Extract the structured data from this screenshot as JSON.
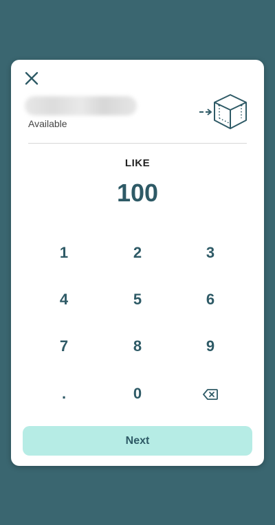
{
  "header": {
    "available_label": "Available"
  },
  "asset": {
    "symbol": "LIKE",
    "amount": "100"
  },
  "keypad": {
    "keys": [
      "1",
      "2",
      "3",
      "4",
      "5",
      "6",
      "7",
      "8",
      "9",
      ".",
      "0"
    ],
    "backspace_icon": "backspace-icon"
  },
  "footer": {
    "next_label": "Next"
  },
  "colors": {
    "background": "#3a6670",
    "accent": "#2e5a66",
    "button": "#b6ece5"
  }
}
